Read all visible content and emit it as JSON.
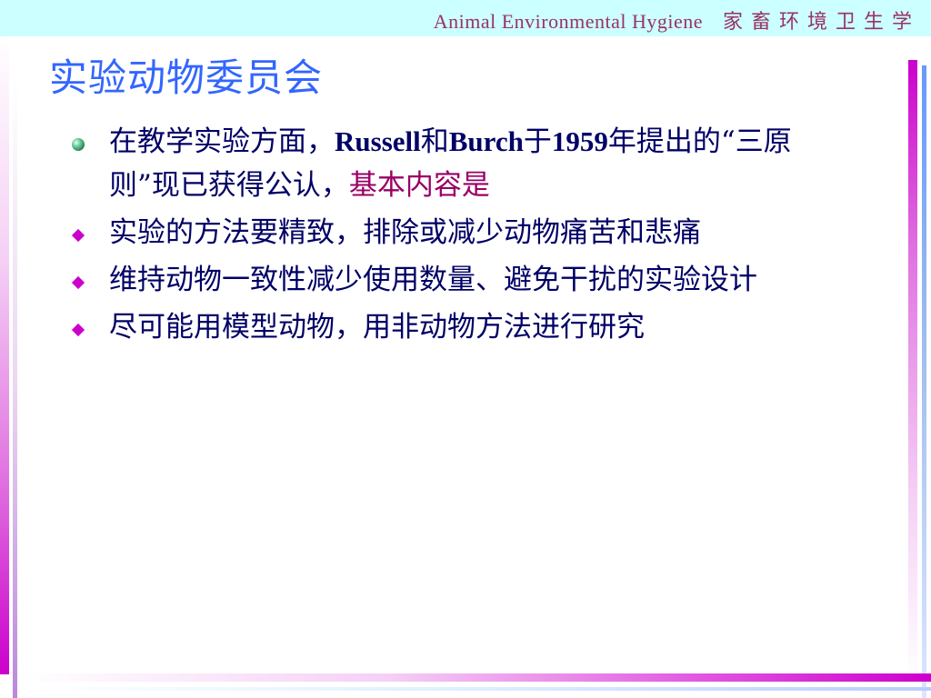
{
  "header": {
    "english": "Animal  Environmental  Hygiene",
    "chinese": "家畜环境卫生学"
  },
  "title": "实验动物委员会",
  "bullets": [
    {
      "marker": "green-ball-icon",
      "parts": {
        "p1": "在教学实验方面，",
        "p2": "Russell",
        "p3": "和",
        "p4": "Burch",
        "p5": "于",
        "p6": "1959",
        "p7": "年提出的“三原则”现已获得公认，",
        "p8": "基本内容是"
      }
    },
    {
      "marker": "magenta-diamond-icon",
      "text": " 实验的方法要精致，排除或减少动物痛苦和悲痛"
    },
    {
      "marker": "magenta-diamond-icon",
      "text": "维持动物一致性减少使用数量、避免干扰的实验设计"
    },
    {
      "marker": "magenta-diamond-icon",
      "text": "尽可能用模型动物，用非动物方法进行研究"
    }
  ],
  "colors": {
    "header_band": "#ccffff",
    "header_text": "#993366",
    "title": "#3366ff",
    "body_text": "#000066",
    "emphasis": "#990066",
    "diamond": "#cc00cc"
  }
}
